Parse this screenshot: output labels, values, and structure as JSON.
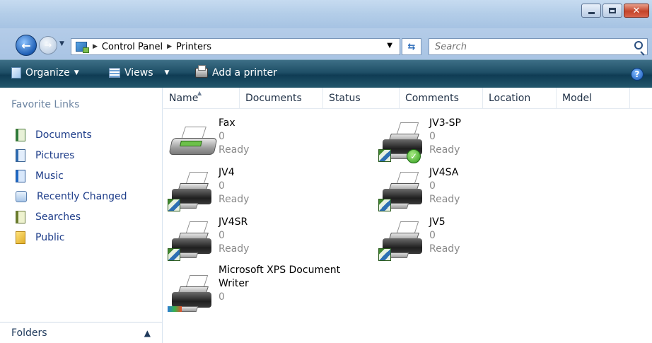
{
  "window": {
    "minimize_label": "",
    "maximize_label": "",
    "close_label": "✕"
  },
  "address": {
    "crumbs": [
      "Control Panel",
      "Printers"
    ],
    "search_placeholder": "Search"
  },
  "commandbar": {
    "organize_label": "Organize",
    "views_label": "Views",
    "add_printer_label": "Add a printer",
    "help_label": "?"
  },
  "navpane": {
    "heading": "Favorite Links",
    "items": [
      {
        "label": "Documents",
        "icon": "documents-icon"
      },
      {
        "label": "Pictures",
        "icon": "pictures-icon"
      },
      {
        "label": "Music",
        "icon": "music-icon"
      },
      {
        "label": "Recently Changed",
        "icon": "recently-changed-icon"
      },
      {
        "label": "Searches",
        "icon": "searches-icon"
      },
      {
        "label": "Public",
        "icon": "public-folder-icon"
      }
    ],
    "folders_label": "Folders"
  },
  "columns": [
    "Name",
    "Documents",
    "Status",
    "Comments",
    "Location",
    "Model"
  ],
  "printers": [
    {
      "name": "Fax",
      "documents": "0",
      "status": "Ready",
      "icon": "fax-icon"
    },
    {
      "name": "JV3-SP",
      "documents": "0",
      "status": "Ready",
      "icon": "network-printer-icon",
      "default": true
    },
    {
      "name": "JV4",
      "documents": "0",
      "status": "Ready",
      "icon": "network-printer-icon"
    },
    {
      "name": "JV4SA",
      "documents": "0",
      "status": "Ready",
      "icon": "network-printer-icon"
    },
    {
      "name": "JV4SR",
      "documents": "0",
      "status": "Ready",
      "icon": "network-printer-icon"
    },
    {
      "name": "JV5",
      "documents": "0",
      "status": "Ready",
      "icon": "network-printer-icon"
    },
    {
      "name": "Microsoft XPS Document Writer",
      "documents": "0",
      "status": "",
      "icon": "xps-printer-icon"
    }
  ],
  "colors": {
    "command_bar": "#1e4e66",
    "link_text": "#1f3e8a",
    "muted_text": "#8a8a8a"
  }
}
